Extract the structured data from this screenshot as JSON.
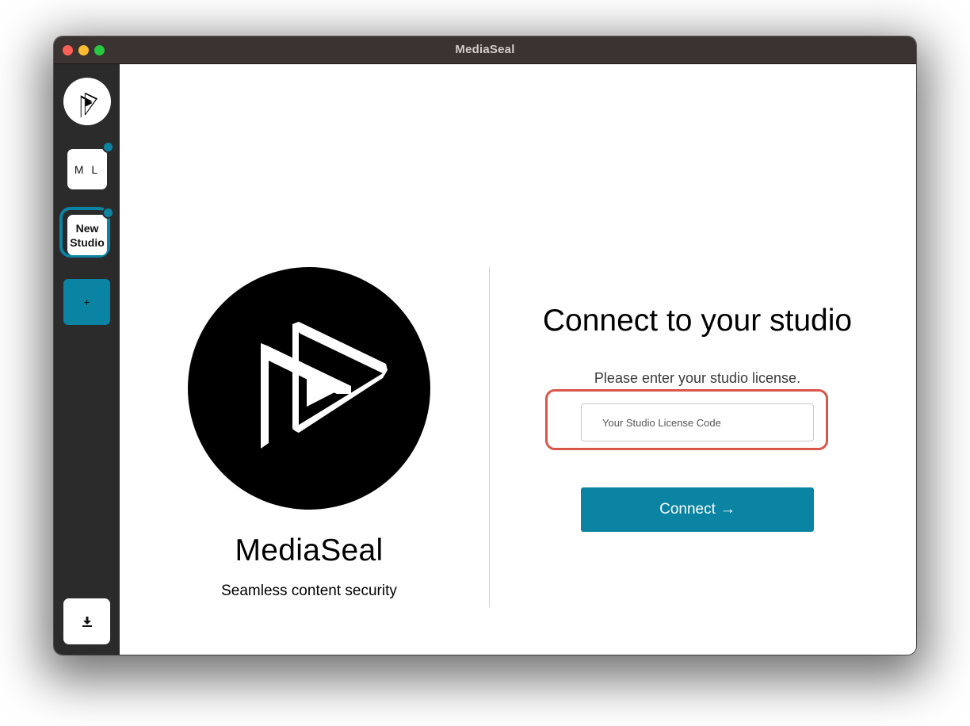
{
  "window": {
    "title": "MediaSeal"
  },
  "sidebar": {
    "logo_icon": "mediaseal-logo-icon",
    "studios": [
      {
        "label": "M L",
        "has_notification": true,
        "selected": false
      },
      {
        "label_line1": "New",
        "label_line2": "Studio",
        "has_notification": true,
        "selected": true
      }
    ],
    "add_label": "+",
    "download_icon": "download-icon"
  },
  "brand": {
    "name": "MediaSeal",
    "tagline": "Seamless content security"
  },
  "connect": {
    "title": "Connect to your studio",
    "hint": "Please enter your studio license.",
    "input_placeholder": "Your Studio License Code",
    "input_value": "",
    "button_label": "Connect",
    "button_arrow": "→"
  },
  "colors": {
    "accent": "#0a84a2",
    "sidebar_bg": "#2b2b2b",
    "titlebar_bg": "#3b3332",
    "highlight": "#d8574a"
  }
}
